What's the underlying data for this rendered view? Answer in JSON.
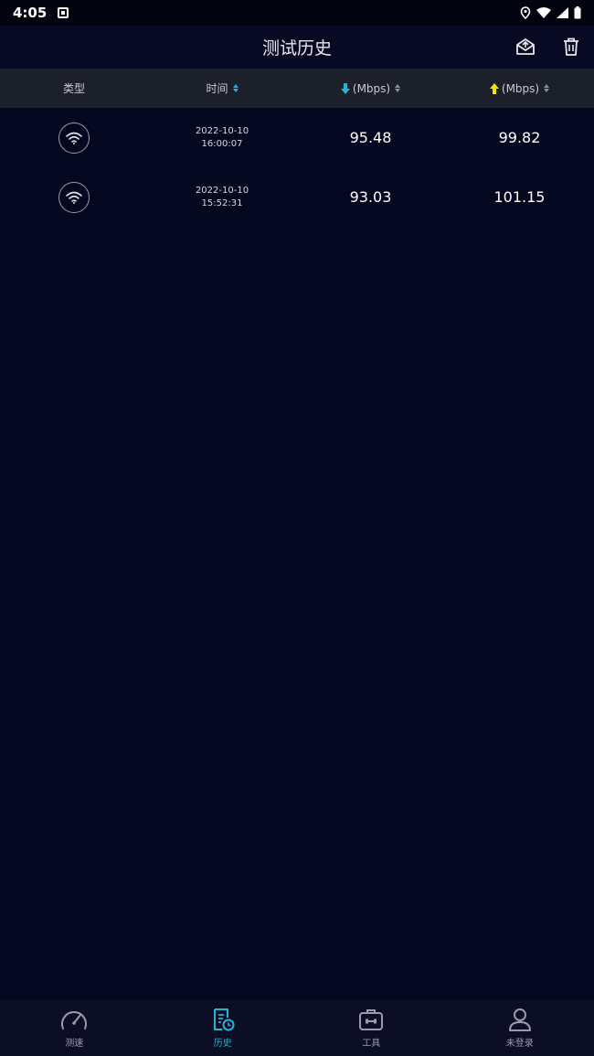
{
  "status_bar": {
    "time": "4:05"
  },
  "header": {
    "title": "测试历史"
  },
  "table": {
    "columns": [
      {
        "label": "类型"
      },
      {
        "label": "时间"
      },
      {
        "label": "(Mbps)"
      },
      {
        "label": "(Mbps)"
      }
    ],
    "rows": [
      {
        "type_icon": "wifi-icon",
        "date": "2022-10-10",
        "time": "16:00:07",
        "download": "95.48",
        "upload": "99.82"
      },
      {
        "type_icon": "wifi-icon",
        "date": "2022-10-10",
        "time": "15:52:31",
        "download": "93.03",
        "upload": "101.15"
      }
    ]
  },
  "colors": {
    "background": "#040720",
    "accent": "#1fb6d8",
    "upload_arrow": "#f5e500",
    "download_arrow": "#1fb6d8"
  },
  "bottom_nav": [
    {
      "label": "测速",
      "icon": "speedometer-icon",
      "active": false
    },
    {
      "label": "历史",
      "icon": "history-icon",
      "active": true
    },
    {
      "label": "工具",
      "icon": "toolbox-icon",
      "active": false
    },
    {
      "label": "未登录",
      "icon": "user-icon",
      "active": false
    }
  ]
}
